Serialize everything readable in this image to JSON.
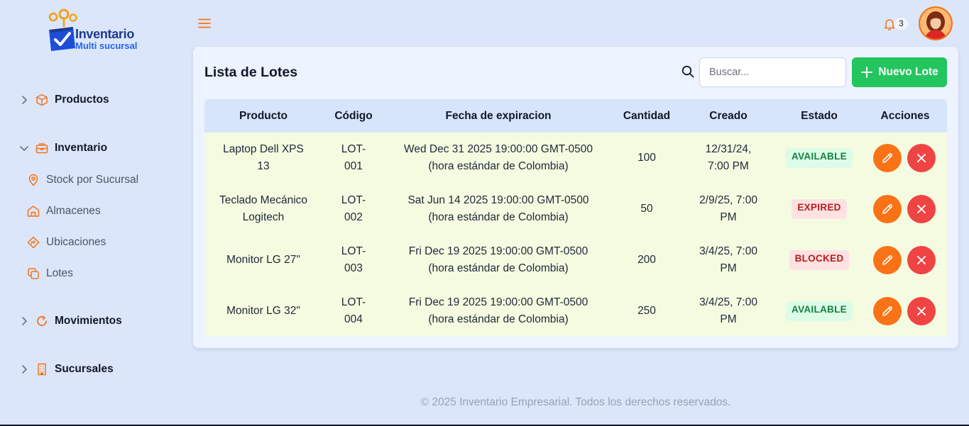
{
  "brand": {
    "title": "Inventario",
    "subtitle": "Multi sucursal"
  },
  "sidebar": {
    "groups": [
      {
        "label": "Productos",
        "icon": "box-icon",
        "expanded": false
      },
      {
        "label": "Inventario",
        "icon": "briefcase-icon",
        "expanded": true
      },
      {
        "label": "Movimientos",
        "icon": "refresh-icon",
        "expanded": false
      },
      {
        "label": "Sucursales",
        "icon": "building-icon",
        "expanded": false
      }
    ],
    "inventario_items": [
      {
        "label": "Stock por Sucursal",
        "icon": "map-pin-icon"
      },
      {
        "label": "Almacenes",
        "icon": "warehouse-icon"
      },
      {
        "label": "Ubicaciones",
        "icon": "directions-icon"
      },
      {
        "label": "Lotes",
        "icon": "copy-icon"
      }
    ]
  },
  "header": {
    "notification_count": "3",
    "accent_color": "#f97316"
  },
  "main": {
    "title": "Lista de Lotes",
    "search_placeholder": "Buscar...",
    "new_button_label": "Nuevo Lote",
    "columns": [
      "Producto",
      "Código",
      "Fecha de expiracion",
      "Cantidad",
      "Creado",
      "Estado",
      "Acciones"
    ],
    "rows": [
      {
        "producto": [
          "Laptop Dell XPS",
          "13"
        ],
        "codigo": [
          "LOT-",
          "001"
        ],
        "fecha": [
          "Wed Dec 31 2025 19:00:00 GMT-0500",
          "(hora estándar de Colombia)"
        ],
        "cantidad": "100",
        "creado": [
          "12/31/24,",
          "7:00 PM"
        ],
        "estado": "AVAILABLE",
        "estado_class": "available"
      },
      {
        "producto": [
          "Teclado Mecánico",
          "Logitech"
        ],
        "codigo": [
          "LOT-",
          "002"
        ],
        "fecha": [
          "Sat Jun 14 2025 19:00:00 GMT-0500",
          "(hora estándar de Colombia)"
        ],
        "cantidad": "50",
        "creado": [
          "2/9/25, 7:00",
          "PM"
        ],
        "estado": "EXPIRED",
        "estado_class": "expired"
      },
      {
        "producto": [
          "Monitor LG 27\""
        ],
        "codigo": [
          "LOT-",
          "003"
        ],
        "fecha": [
          "Fri Dec 19 2025 19:00:00 GMT-0500",
          "(hora estándar de Colombia)"
        ],
        "cantidad": "200",
        "creado": [
          "3/4/25, 7:00",
          "PM"
        ],
        "estado": "BLOCKED",
        "estado_class": "blocked"
      },
      {
        "producto": [
          "Monitor LG 32\""
        ],
        "codigo": [
          "LOT-",
          "004"
        ],
        "fecha": [
          "Fri Dec 19 2025 19:00:00 GMT-0500",
          "(hora estándar de Colombia)"
        ],
        "cantidad": "250",
        "creado": [
          "3/4/25, 7:00",
          "PM"
        ],
        "estado": "AVAILABLE",
        "estado_class": "available"
      }
    ]
  },
  "footer": {
    "text": "© 2025 Inventario Empresarial. Todos los derechos reservados."
  }
}
